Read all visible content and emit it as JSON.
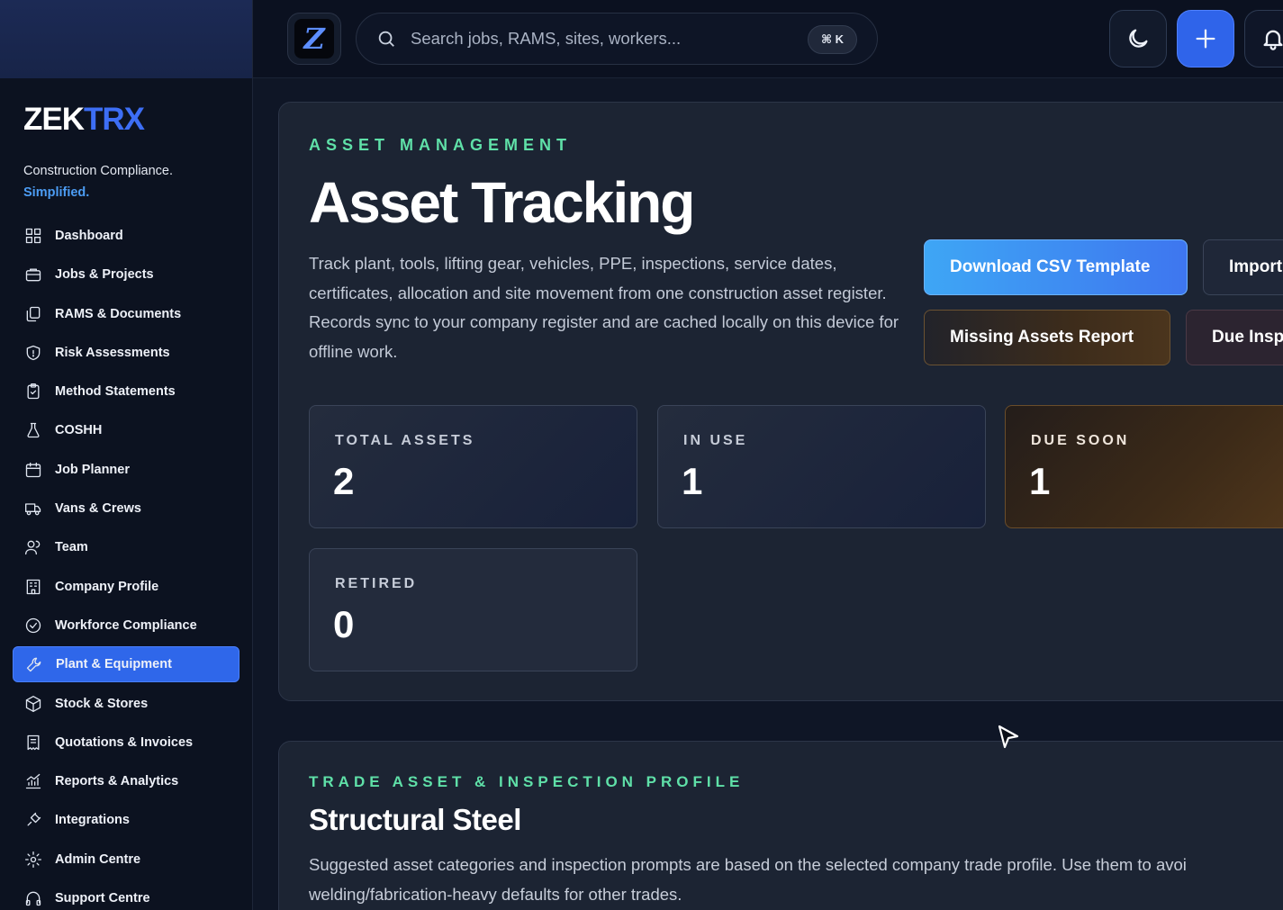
{
  "brand": {
    "logo_part1": "ZEK",
    "logo_part2": "TRX",
    "tagline": "Construction Compliance.",
    "tagline_highlight": "Simplified."
  },
  "sidebar": {
    "items": [
      {
        "label": "Dashboard",
        "icon": "dashboard-icon",
        "active": false
      },
      {
        "label": "Jobs & Projects",
        "icon": "briefcase-icon",
        "active": false
      },
      {
        "label": "RAMS & Documents",
        "icon": "documents-icon",
        "active": false
      },
      {
        "label": "Risk Assessments",
        "icon": "shield-icon",
        "active": false
      },
      {
        "label": "Method Statements",
        "icon": "clipboard-check-icon",
        "active": false
      },
      {
        "label": "COSHH",
        "icon": "flask-icon",
        "active": false
      },
      {
        "label": "Job Planner",
        "icon": "calendar-icon",
        "active": false
      },
      {
        "label": "Vans & Crews",
        "icon": "truck-icon",
        "active": false
      },
      {
        "label": "Team",
        "icon": "users-icon",
        "active": false
      },
      {
        "label": "Company Profile",
        "icon": "building-icon",
        "active": false
      },
      {
        "label": "Workforce Compliance",
        "icon": "check-circle-icon",
        "active": false
      },
      {
        "label": "Plant & Equipment",
        "icon": "wrench-icon",
        "active": true
      },
      {
        "label": "Stock & Stores",
        "icon": "package-icon",
        "active": false
      },
      {
        "label": "Quotations & Invoices",
        "icon": "receipt-icon",
        "active": false
      },
      {
        "label": "Reports & Analytics",
        "icon": "chart-icon",
        "active": false
      },
      {
        "label": "Integrations",
        "icon": "plug-icon",
        "active": false
      },
      {
        "label": "Admin Centre",
        "icon": "gear-icon",
        "active": false
      },
      {
        "label": "Support Centre",
        "icon": "headphones-icon",
        "active": false
      }
    ]
  },
  "topbar": {
    "app_icon_letter": "Z",
    "search_placeholder": "Search jobs, RAMS, sites, workers...",
    "search_shortcut": "⌘ K"
  },
  "hero": {
    "eyebrow": "ASSET MANAGEMENT",
    "title": "Asset Tracking",
    "description": "Track plant, tools, lifting gear, vehicles, PPE, inspections, service dates, certificates, allocation and site movement from one construction asset register. Records sync to your company register and are cached locally on this device for offline work.",
    "actions": {
      "download_csv": "Download CSV Template",
      "import": "Import",
      "missing_report": "Missing Assets Report",
      "due_inspections": "Due Insp"
    },
    "stats": [
      {
        "label": "TOTAL ASSETS",
        "value": "2"
      },
      {
        "label": "IN USE",
        "value": "1"
      },
      {
        "label": "DUE SOON",
        "value": "1"
      },
      {
        "label": "RETIRED",
        "value": "0"
      }
    ]
  },
  "profile": {
    "eyebrow": "TRADE ASSET & INSPECTION PROFILE",
    "title": "Structural Steel",
    "description": "Suggested asset categories and inspection prompts are based on the selected company trade profile. Use them to avoi welding/fabrication-heavy defaults for other trades."
  },
  "colors": {
    "accent": "#2f67ea",
    "eyebrow": "#5fe0a8",
    "brand_blue": "#3d6ef5"
  }
}
